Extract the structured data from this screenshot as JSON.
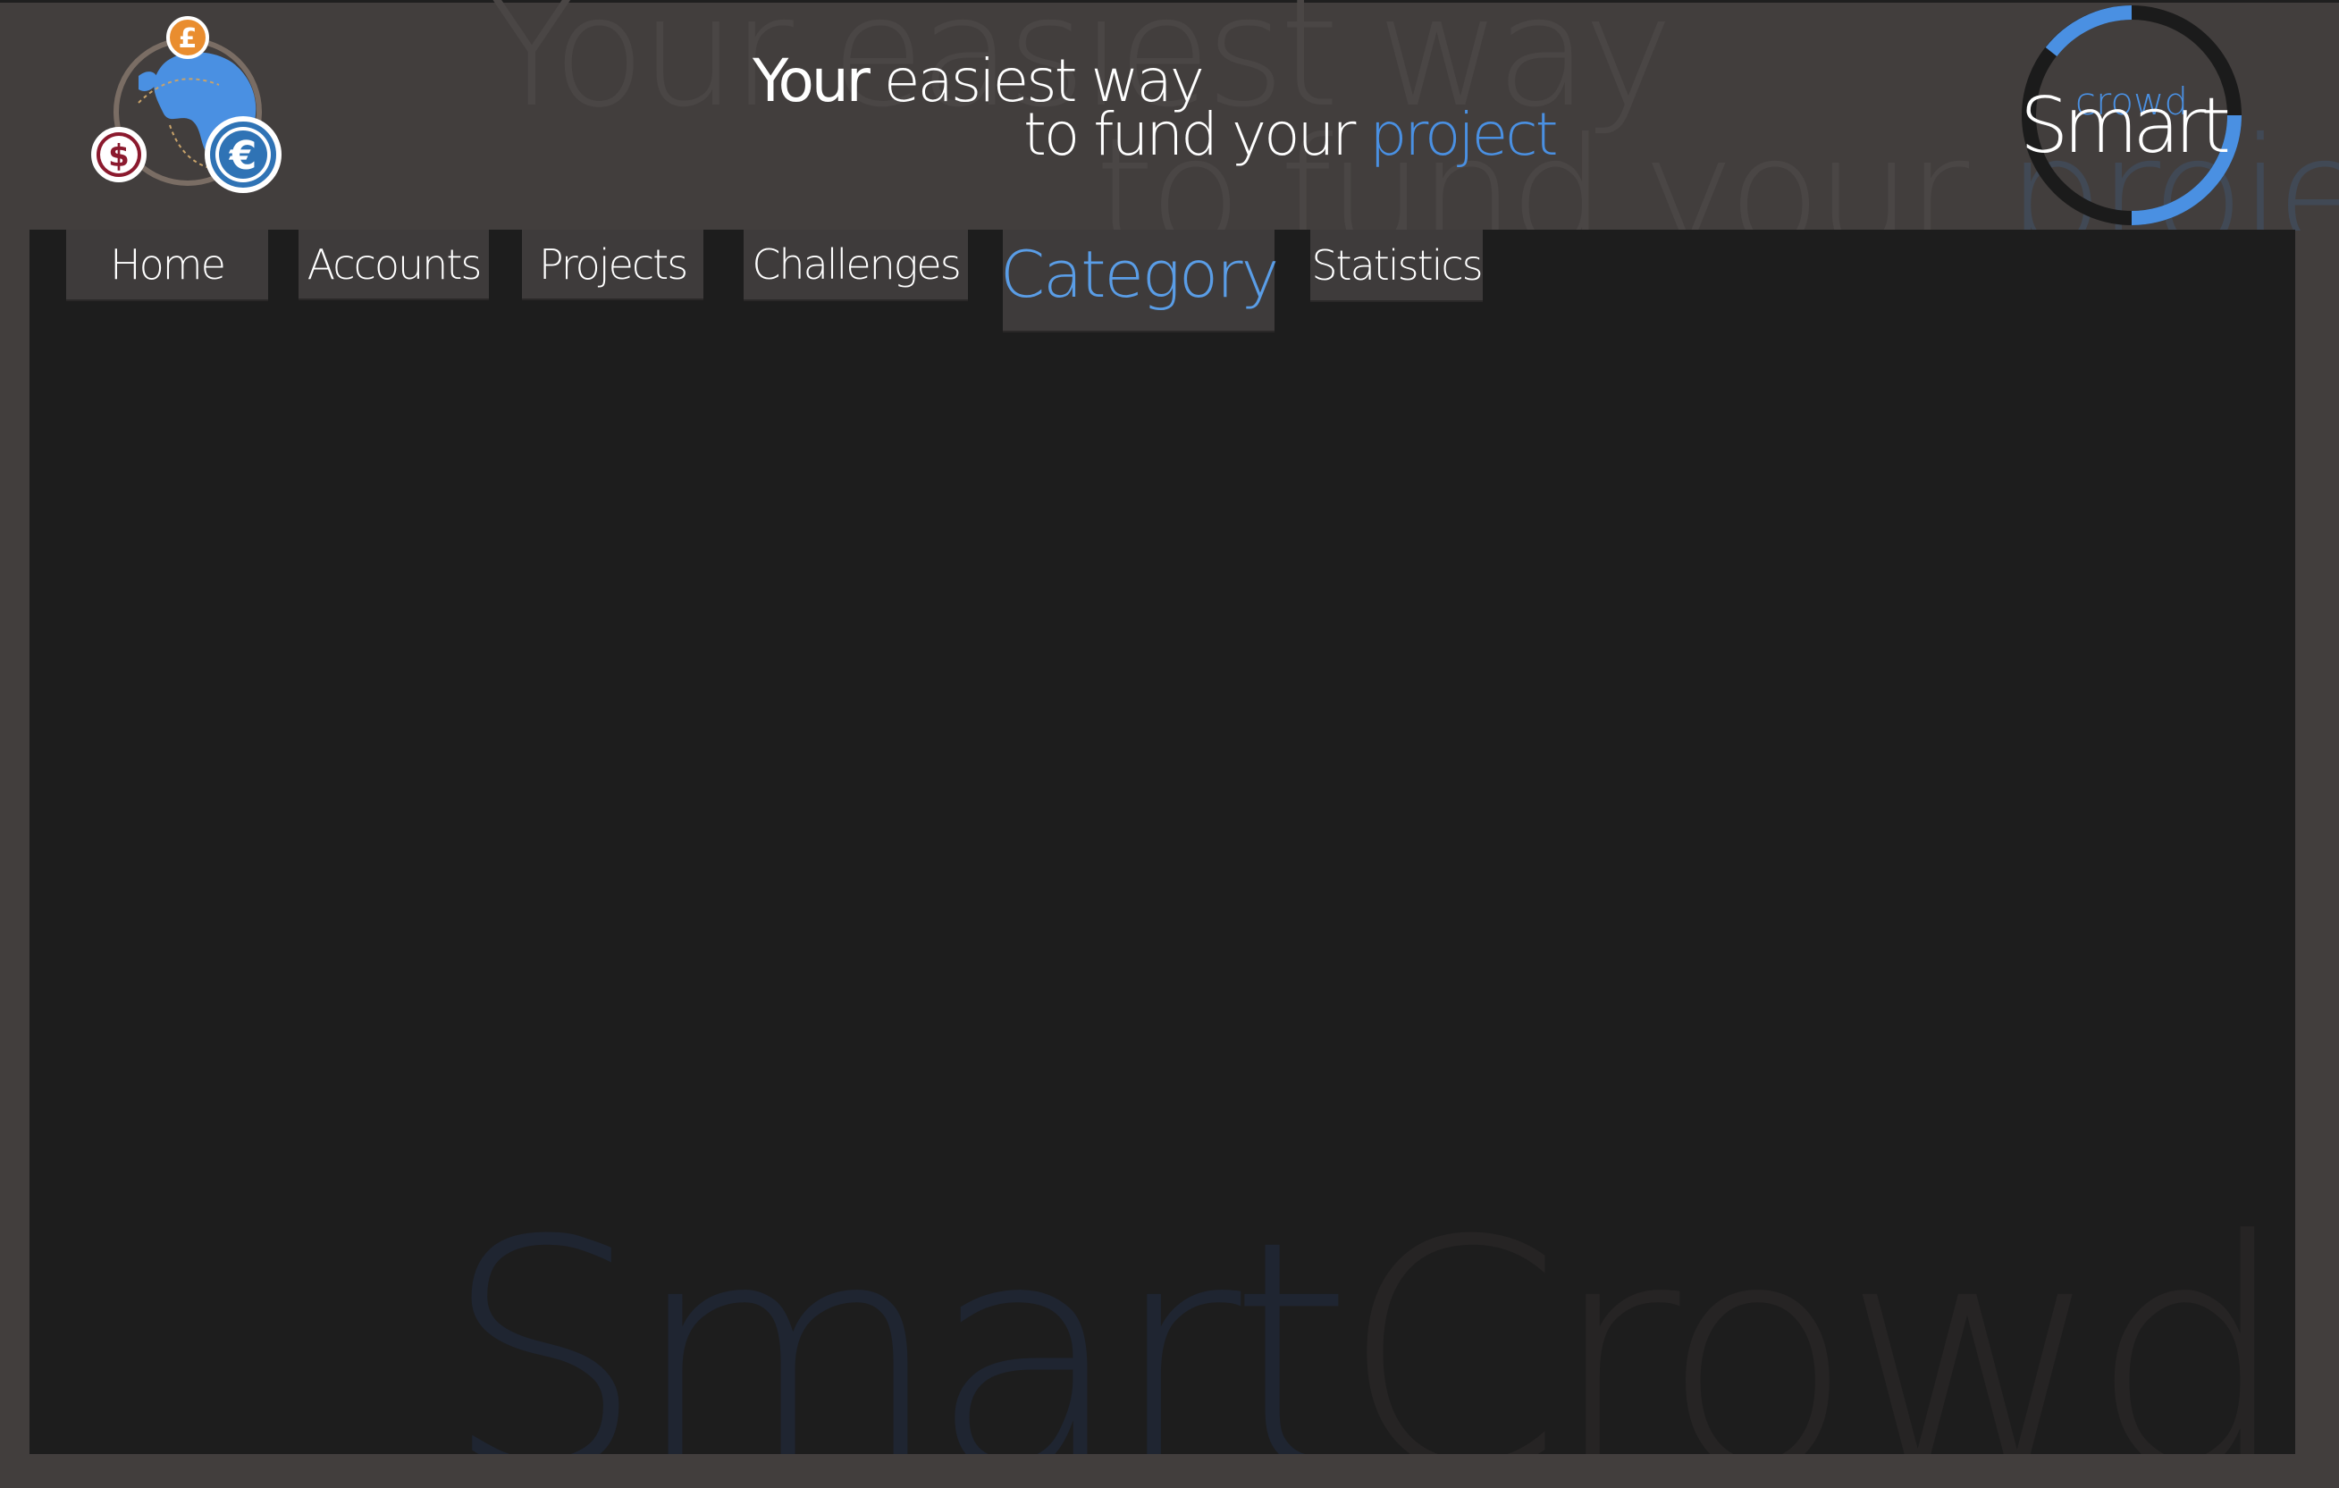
{
  "header": {
    "ghost_line_1": "Your easiest way",
    "ghost_line_2_prefix": "to fund your ",
    "ghost_line_2_accent": "project",
    "tagline_1_strong": "Your",
    "tagline_1_rest": " easiest way",
    "tagline_2_prefix": "to fund your ",
    "tagline_2_accent": "project",
    "logo_left": {
      "icon": "globe-currency-icon",
      "symbols": {
        "pound": "£",
        "dollar": "$",
        "euro": "€"
      }
    },
    "logo_right": {
      "word_small": "crowd",
      "word_large": "Smart"
    }
  },
  "nav": {
    "tabs": [
      {
        "label": "Home"
      },
      {
        "label": "Accounts"
      },
      {
        "label": "Projects"
      },
      {
        "label": "Challenges"
      },
      {
        "label": "Category",
        "active": true
      },
      {
        "label": "Statistics"
      }
    ]
  },
  "watermark": {
    "part_1": "Smart",
    "part_2": "Crowd"
  },
  "colors": {
    "background": "#423e3d",
    "panel": "#1d1d1d",
    "tab": "#3e3b3b",
    "accent": "#4a90e2",
    "active_tab_text": "#5a9de6"
  }
}
